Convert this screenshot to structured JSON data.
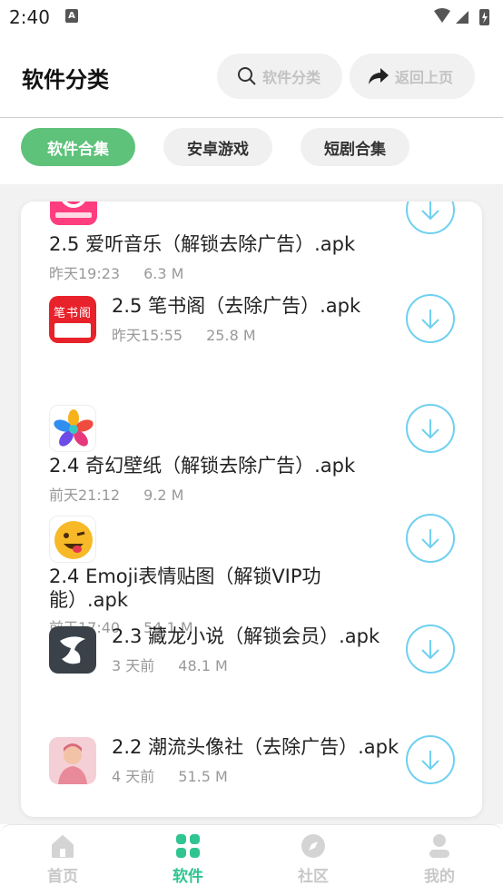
{
  "status_bar": {
    "time": "2:40",
    "notif_letter": "A"
  },
  "header": {
    "title": "软件分类",
    "search_label": "软件分类",
    "back_label": "返回上页"
  },
  "tabs": [
    {
      "label": "软件合集",
      "active": true
    },
    {
      "label": "安卓游戏",
      "active": false
    },
    {
      "label": "短剧合集",
      "active": false
    }
  ],
  "apps": [
    {
      "name": "2.5 爱听音乐（解锁去除广告）.apk",
      "date": "昨天19:23",
      "size": "6.3 M",
      "icon": "music-app-icon"
    },
    {
      "name": "2.5 笔书阁（去除广告）.apk",
      "date": "昨天15:55",
      "size": "25.8 M",
      "icon": "book-app-icon",
      "icon_text": "笔书阁"
    },
    {
      "name": "2.4 奇幻壁纸（解锁去除广告）.apk",
      "date": "前天21:12",
      "size": "9.2 M",
      "icon": "wallpaper-app-icon"
    },
    {
      "name": "2.4 Emoji表情贴图（解锁VIP功能）.apk",
      "date": "前天17:40",
      "size": "54.1 M",
      "icon": "emoji-app-icon"
    },
    {
      "name": "2.3 藏龙小说（解锁会员）.apk",
      "date": "3 天前",
      "size": "48.1 M",
      "icon": "novel-app-icon"
    },
    {
      "name": "2.2 潮流头像社（去除广告）.apk",
      "date": "4 天前",
      "size": "51.5 M",
      "icon": "avatar-app-icon"
    }
  ],
  "bottom_nav": [
    {
      "label": "首页",
      "active": false
    },
    {
      "label": "软件",
      "active": true
    },
    {
      "label": "社区",
      "active": false
    },
    {
      "label": "我的",
      "active": false
    }
  ],
  "colors": {
    "accent_green": "#5ec27a",
    "nav_active": "#2fc490",
    "download_ring": "#6fd0f0"
  }
}
